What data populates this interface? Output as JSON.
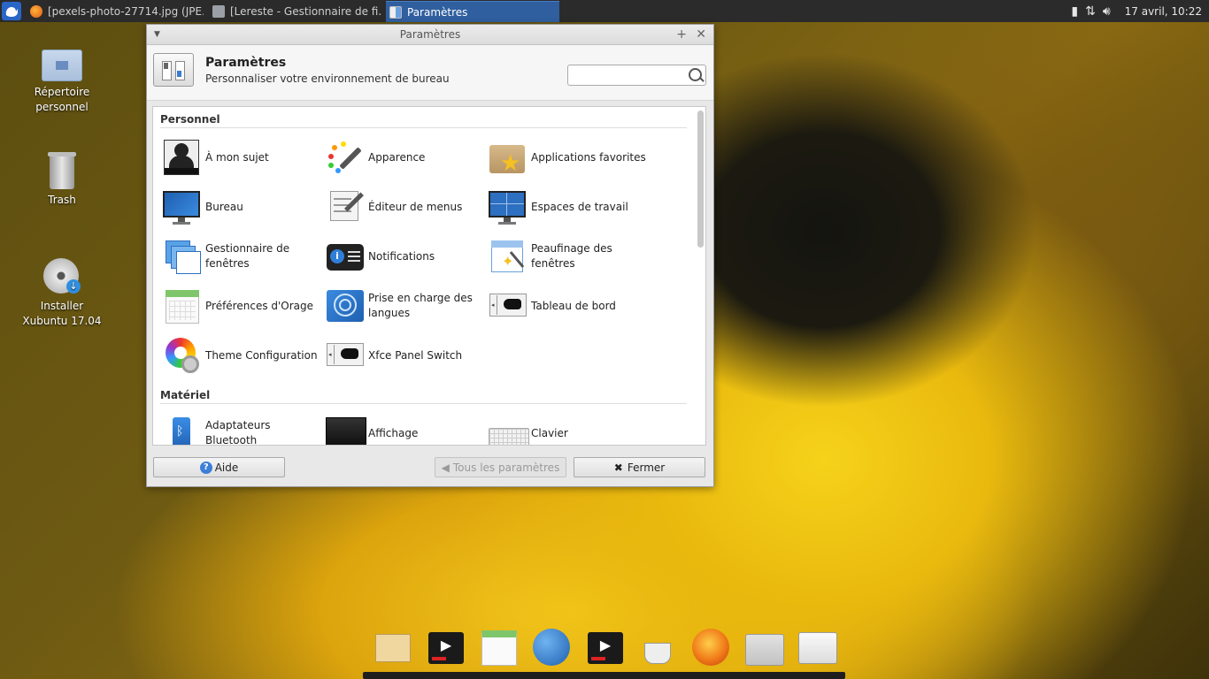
{
  "top_panel": {
    "tasks": [
      {
        "label": "[pexels-photo-27714.jpg (JPE...",
        "icon": "firefox-icon"
      },
      {
        "label": "[Lereste - Gestionnaire de fi...",
        "icon": "folder-icon"
      },
      {
        "label": "Paramètres",
        "icon": "settings-icon"
      }
    ],
    "clock": "17 avril, 10:22"
  },
  "desktop": {
    "icons": [
      {
        "label": "Répertoire personnel",
        "icon": "home-folder-icon"
      },
      {
        "label": "Trash",
        "icon": "trash-icon"
      },
      {
        "label": "Installer Xubuntu 17.04",
        "icon": "install-disc-icon"
      }
    ]
  },
  "window": {
    "title": "Paramètres",
    "header_title": "Paramètres",
    "header_subtitle": "Personnaliser votre environnement de bureau",
    "search_value": "",
    "sections": [
      {
        "name": "Personnel",
        "items": [
          {
            "label": "À mon sujet",
            "icon": "about-me-icon"
          },
          {
            "label": "Apparence",
            "icon": "appearance-icon"
          },
          {
            "label": "Applications favorites",
            "icon": "favorite-apps-icon"
          },
          {
            "label": "Bureau",
            "icon": "desktop-icon"
          },
          {
            "label": "Éditeur de menus",
            "icon": "menu-editor-icon"
          },
          {
            "label": "Espaces de travail",
            "icon": "workspaces-icon"
          },
          {
            "label": "Gestionnaire de fenêtres",
            "icon": "window-manager-icon"
          },
          {
            "label": "Notifications",
            "icon": "notifications-icon"
          },
          {
            "label": "Peaufinage des fenêtres",
            "icon": "window-tweaks-icon"
          },
          {
            "label": "Préférences d'Orage",
            "icon": "orage-calendar-icon"
          },
          {
            "label": "Prise en charge des langues",
            "icon": "language-support-icon"
          },
          {
            "label": "Tableau de bord",
            "icon": "panel-icon"
          },
          {
            "label": "Theme Configuration",
            "icon": "theme-config-icon"
          },
          {
            "label": "Xfce Panel Switch",
            "icon": "panel-switch-icon"
          }
        ]
      },
      {
        "name": "Matériel",
        "items": [
          {
            "label": "Adaptateurs Bluetooth",
            "icon": "bluetooth-icon"
          },
          {
            "label": "Affichage",
            "icon": "display-icon"
          },
          {
            "label": "Clavier",
            "icon": "keyboard-icon"
          }
        ]
      }
    ],
    "buttons": {
      "help": "Aide",
      "all_settings": "Tous les paramètres",
      "close": "Fermer"
    }
  },
  "dock": {
    "launchers": [
      "mail-icon",
      "media-player-icon",
      "calendar-icon",
      "web-browser-icon",
      "media-player-icon",
      "caffeine-icon",
      "firefox-icon",
      "home-folder-icon",
      "settings-icon"
    ]
  }
}
